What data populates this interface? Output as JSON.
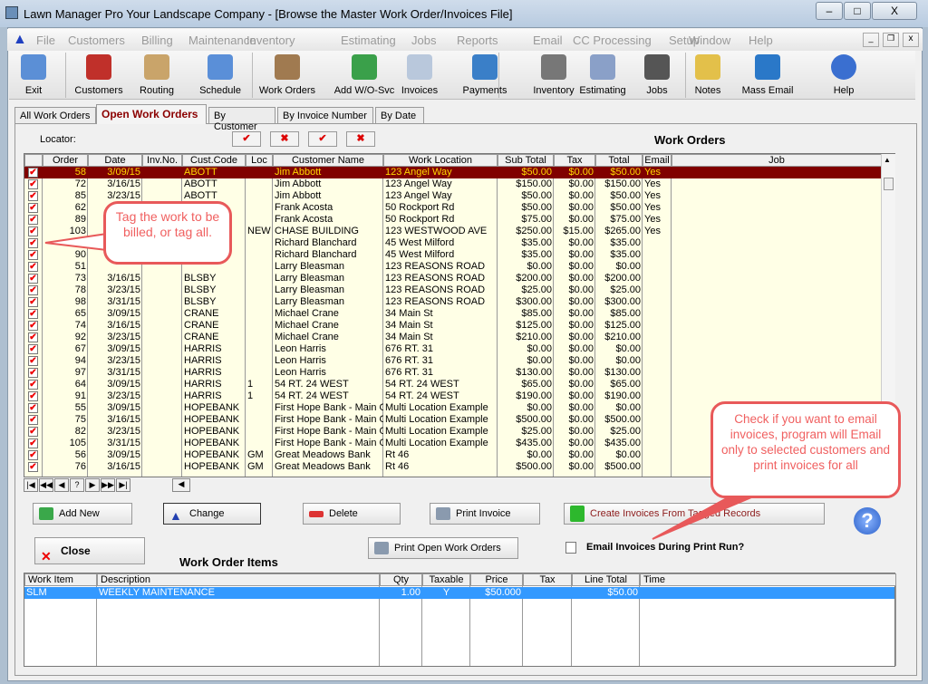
{
  "window": {
    "title": "Lawn Manager Pro  Your Landscape Company - [Browse the Master Work Order/Invoices File]",
    "minimize": "–",
    "maximize": "□",
    "close": "X"
  },
  "menu": [
    "File",
    "Customers",
    "Billing",
    "Maintenance",
    "Inventory",
    "Estimating",
    "Jobs",
    "Reports",
    "Email",
    "CC Processing",
    "Setup",
    "Window",
    "Help"
  ],
  "toolbar": [
    {
      "label": "Exit",
      "icon": "exit-icon",
      "color": "#5b8fd6"
    },
    {
      "label": "Customers",
      "icon": "customers-icon",
      "color": "#c0302a"
    },
    {
      "label": "Routing",
      "icon": "routing-icon",
      "color": "#c9a46a"
    },
    {
      "label": "Schedule",
      "icon": "schedule-icon",
      "color": "#5a8fd8"
    },
    {
      "label": "Work Orders",
      "icon": "work-orders-icon",
      "color": "#a07a50"
    },
    {
      "label": "Add W/O-Svc",
      "icon": "add-work-order-icon",
      "color": "#3aa04a"
    },
    {
      "label": "Invoices",
      "icon": "invoices-icon",
      "color": "#b9c8dc"
    },
    {
      "label": "Payments",
      "icon": "payments-icon",
      "color": "#3a7fc8"
    },
    {
      "label": "Inventory",
      "icon": "inventory-icon",
      "color": "#777777"
    },
    {
      "label": "Estimating",
      "icon": "estimating-icon",
      "color": "#8aa0c8"
    },
    {
      "label": "Jobs",
      "icon": "jobs-icon",
      "color": "#555555"
    },
    {
      "label": "Notes",
      "icon": "notes-icon",
      "color": "#e3c04a"
    },
    {
      "label": "Mass Email",
      "icon": "mass-email-icon",
      "color": "#2a78c8"
    },
    {
      "label": "Help",
      "icon": "help-icon",
      "color": "#3a6fd0"
    }
  ],
  "tabs": [
    "All Work Orders",
    "Open Work Orders",
    "By Customer",
    "By Invoice Number",
    "By Date"
  ],
  "locator_label": "Locator:",
  "grid_title": "Work Orders",
  "columns": [
    "Order No.",
    "Date",
    "Inv.No.",
    "Cust.Code",
    "Loc",
    "Customer Name",
    "Work Location",
    "Sub Total",
    "Tax",
    "Total",
    "Email",
    "Job"
  ],
  "rows": [
    [
      "58",
      "3/09/15",
      "",
      "ABOTT",
      "",
      "Jim Abbott",
      "123 Angel Way",
      "$50.00",
      "$0.00",
      "$50.00",
      "Yes",
      ""
    ],
    [
      "72",
      "3/16/15",
      "",
      "ABOTT",
      "",
      "Jim Abbott",
      "123 Angel Way",
      "$150.00",
      "$0.00",
      "$150.00",
      "Yes",
      ""
    ],
    [
      "85",
      "3/23/15",
      "",
      "ABOTT",
      "",
      "Jim Abbott",
      "123 Angel Way",
      "$50.00",
      "$0.00",
      "$50.00",
      "Yes",
      ""
    ],
    [
      "62",
      "",
      "",
      "",
      "",
      "Frank Acosta",
      "50 Rockport Rd",
      "$50.00",
      "$0.00",
      "$50.00",
      "Yes",
      ""
    ],
    [
      "89",
      "",
      "",
      "",
      "",
      "Frank Acosta",
      "50 Rockport Rd",
      "$75.00",
      "$0.00",
      "$75.00",
      "Yes",
      ""
    ],
    [
      "103",
      "",
      "",
      "",
      "NEW",
      "CHASE BUILDING",
      "123 WESTWOOD AVE",
      "$250.00",
      "$15.00",
      "$265.00",
      "Yes",
      ""
    ],
    [
      "",
      "",
      "",
      "",
      "",
      "Richard Blanchard",
      "45 West Milford",
      "$35.00",
      "$0.00",
      "$35.00",
      "",
      ""
    ],
    [
      "90",
      "",
      "",
      "",
      "",
      "Richard Blanchard",
      "45 West Milford",
      "$35.00",
      "$0.00",
      "$35.00",
      "",
      ""
    ],
    [
      "51",
      "",
      "",
      "",
      "",
      "Larry Bleasman",
      "123 REASONS ROAD",
      "$0.00",
      "$0.00",
      "$0.00",
      "",
      ""
    ],
    [
      "73",
      "3/16/15",
      "",
      "BLSBY",
      "",
      "Larry Bleasman",
      "123 REASONS ROAD",
      "$200.00",
      "$0.00",
      "$200.00",
      "",
      ""
    ],
    [
      "78",
      "3/23/15",
      "",
      "BLSBY",
      "",
      "Larry Bleasman",
      "123 REASONS ROAD",
      "$25.00",
      "$0.00",
      "$25.00",
      "",
      ""
    ],
    [
      "98",
      "3/31/15",
      "",
      "BLSBY",
      "",
      "Larry Bleasman",
      "123 REASONS ROAD",
      "$300.00",
      "$0.00",
      "$300.00",
      "",
      ""
    ],
    [
      "65",
      "3/09/15",
      "",
      "CRANE",
      "",
      "Michael Crane",
      "34 Main St",
      "$85.00",
      "$0.00",
      "$85.00",
      "",
      ""
    ],
    [
      "74",
      "3/16/15",
      "",
      "CRANE",
      "",
      "Michael Crane",
      "34 Main St",
      "$125.00",
      "$0.00",
      "$125.00",
      "",
      ""
    ],
    [
      "92",
      "3/23/15",
      "",
      "CRANE",
      "",
      "Michael Crane",
      "34 Main St",
      "$210.00",
      "$0.00",
      "$210.00",
      "",
      ""
    ],
    [
      "67",
      "3/09/15",
      "",
      "HARRIS",
      "",
      "Leon Harris",
      "676 RT. 31",
      "$0.00",
      "$0.00",
      "$0.00",
      "",
      ""
    ],
    [
      "94",
      "3/23/15",
      "",
      "HARRIS",
      "",
      "Leon Harris",
      "676 RT. 31",
      "$0.00",
      "$0.00",
      "$0.00",
      "",
      ""
    ],
    [
      "97",
      "3/31/15",
      "",
      "HARRIS",
      "",
      "Leon Harris",
      "676 RT. 31",
      "$130.00",
      "$0.00",
      "$130.00",
      "",
      ""
    ],
    [
      "64",
      "3/09/15",
      "",
      "HARRIS",
      "1",
      "54 RT. 24 WEST",
      "54 RT. 24 WEST",
      "$65.00",
      "$0.00",
      "$65.00",
      "",
      ""
    ],
    [
      "91",
      "3/23/15",
      "",
      "HARRIS",
      "1",
      "54 RT. 24 WEST",
      "54 RT. 24 WEST",
      "$190.00",
      "$0.00",
      "$190.00",
      "",
      ""
    ],
    [
      "55",
      "3/09/15",
      "",
      "HOPEBANK",
      "",
      "First Hope Bank - Main O",
      "Multi Location Example",
      "$0.00",
      "$0.00",
      "$0.00",
      "",
      ""
    ],
    [
      "75",
      "3/16/15",
      "",
      "HOPEBANK",
      "",
      "First Hope Bank - Main O",
      "Multi Location Example",
      "$500.00",
      "$0.00",
      "$500.00",
      "",
      ""
    ],
    [
      "82",
      "3/23/15",
      "",
      "HOPEBANK",
      "",
      "First Hope Bank - Main O",
      "Multi Location Example",
      "$25.00",
      "$0.00",
      "$25.00",
      "",
      ""
    ],
    [
      "105",
      "3/31/15",
      "",
      "HOPEBANK",
      "",
      "First Hope Bank - Main O",
      "Multi Location Example",
      "$435.00",
      "$0.00",
      "$435.00",
      "",
      ""
    ],
    [
      "56",
      "3/09/15",
      "",
      "HOPEBANK",
      "GM",
      "Great Meadows Bank",
      "Rt 46",
      "$0.00",
      "$0.00",
      "$0.00",
      "",
      ""
    ],
    [
      "76",
      "3/16/15",
      "",
      "HOPEBANK",
      "GM",
      "Great Meadows Bank",
      "Rt 46",
      "$500.00",
      "$0.00",
      "$500.00",
      "",
      ""
    ]
  ],
  "nav": [
    "|◀",
    "◀◀",
    "◀",
    "?",
    "▶",
    "▶▶",
    "▶|"
  ],
  "buttons": {
    "add_new": "Add New",
    "change": "Change",
    "delete": "Delete",
    "print_invoice": "Print Invoice",
    "create_invoice": "Create Invoices From Tagged Records",
    "close": "Close",
    "print_open": "Print Open Work Orders",
    "email_checkbox": "Email Invoices During Print Run?",
    "help": "?"
  },
  "items_title": "Work Order Items",
  "item_columns": [
    "Work Item",
    "Description",
    "Qty",
    "Taxable",
    "Price",
    "Tax",
    "Line Total",
    "Time"
  ],
  "item_rows": [
    [
      "SLM",
      "WEEKLY MAINTENANCE",
      "1.00",
      "Y",
      "$50.000",
      "",
      "$50.00",
      ""
    ]
  ],
  "callouts": {
    "tag": "Tag the work to be billed, or tag all.",
    "email": "Check if you want to email invoices, program will Email only to selected customers and print invoices for all"
  },
  "colors": {
    "selected_row": "#800000",
    "grid_bg": "#ffffe6",
    "item_selected": "#3399ff",
    "callout_border": "#e8595a"
  }
}
